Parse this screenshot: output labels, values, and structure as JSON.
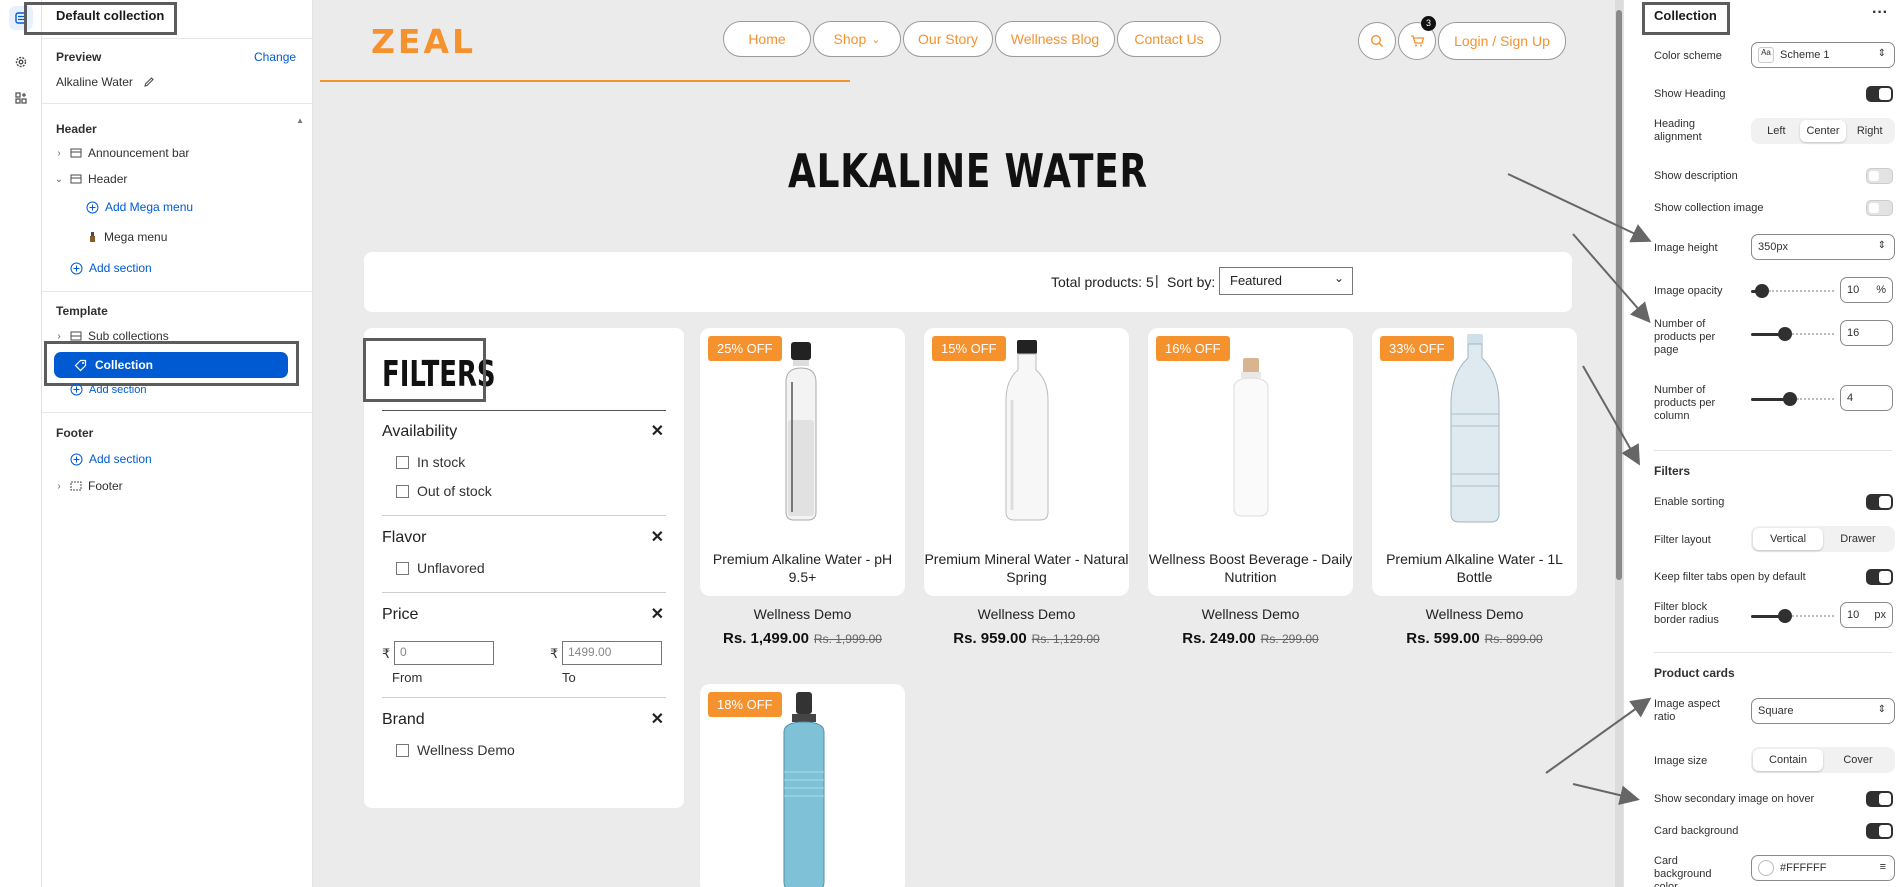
{
  "left_panel": {
    "title": "Default collection",
    "preview_label": "Preview",
    "change_label": "Change",
    "preview_value": "Alkaline Water",
    "header_section": "Header",
    "header_items": [
      "Announcement bar",
      "Header"
    ],
    "add_mega_menu": "Add Mega menu",
    "mega_menu": "Mega menu",
    "add_section": "Add section",
    "template_section": "Template",
    "template_items": [
      "Sub collections",
      "Collection"
    ],
    "footer_section": "Footer",
    "footer_item": "Footer"
  },
  "store": {
    "logo": "ZEAL",
    "nav": [
      "Home",
      "Shop",
      "Our Story",
      "Wellness Blog",
      "Contact Us"
    ],
    "cart_count": "3",
    "login": "Login / Sign Up",
    "page_title": "ALKALINE WATER",
    "total_products": "Total products: 5",
    "sort_by_label": "Sort by:",
    "sort_value": "Featured",
    "filters_title": "FILTERS",
    "filter_groups": [
      {
        "name": "Availability",
        "options": [
          "In stock",
          "Out of stock"
        ]
      },
      {
        "name": "Flavor",
        "options": [
          "Unflavored"
        ]
      },
      {
        "name": "Price"
      },
      {
        "name": "Brand",
        "options": [
          "Wellness Demo"
        ]
      }
    ],
    "price": {
      "currency": "₹",
      "from_placeholder": "0",
      "to_placeholder": "1499.00",
      "from_label": "From",
      "to_label": "To"
    },
    "products": [
      {
        "badge": "25% OFF",
        "name": "Premium Alkaline Water - pH 9.5+",
        "vendor": "Wellness Demo",
        "price": "Rs. 1,499.00",
        "compare": "Rs. 1,999.00"
      },
      {
        "badge": "15% OFF",
        "name": "Premium Mineral Water - Natural Spring",
        "vendor": "Wellness Demo",
        "price": "Rs. 959.00",
        "compare": "Rs. 1,129.00"
      },
      {
        "badge": "16% OFF",
        "name": "Wellness Boost Beverage - Daily Nutrition",
        "vendor": "Wellness Demo",
        "price": "Rs. 249.00",
        "compare": "Rs. 299.00"
      },
      {
        "badge": "33% OFF",
        "name": "Premium Alkaline Water - 1L Bottle",
        "vendor": "Wellness Demo",
        "price": "Rs. 599.00",
        "compare": "Rs. 899.00"
      },
      {
        "badge": "18% OFF"
      }
    ]
  },
  "right_panel": {
    "title": "Collection",
    "color_scheme_label": "Color scheme",
    "color_scheme_value": "Scheme 1",
    "show_heading": "Show Heading",
    "heading_alignment": "Heading alignment",
    "align_options": [
      "Left",
      "Center",
      "Right"
    ],
    "show_description": "Show description",
    "show_collection_image": "Show collection image",
    "image_height": "Image height",
    "image_height_value": "350px",
    "image_opacity": "Image opacity",
    "image_opacity_value": "10",
    "percent": "%",
    "products_per_page": "Number of products per page",
    "products_per_page_value": "16",
    "products_per_column": "Number of products per column",
    "products_per_column_value": "4",
    "filters_heading": "Filters",
    "enable_sorting": "Enable sorting",
    "filter_layout": "Filter layout",
    "filter_layout_options": [
      "Vertical",
      "Drawer"
    ],
    "keep_filter_tabs": "Keep filter tabs open by default",
    "filter_block_radius": "Filter block border radius",
    "filter_block_radius_value": "10",
    "px": "px",
    "product_cards_heading": "Product cards",
    "image_aspect_ratio": "Image aspect ratio",
    "image_aspect_ratio_value": "Square",
    "image_size": "Image size",
    "image_size_options": [
      "Contain",
      "Cover"
    ],
    "show_secondary_image": "Show secondary image on hover",
    "card_background": "Card background",
    "card_background_color": "Card background color",
    "card_background_color_value": "#FFFFFF"
  }
}
